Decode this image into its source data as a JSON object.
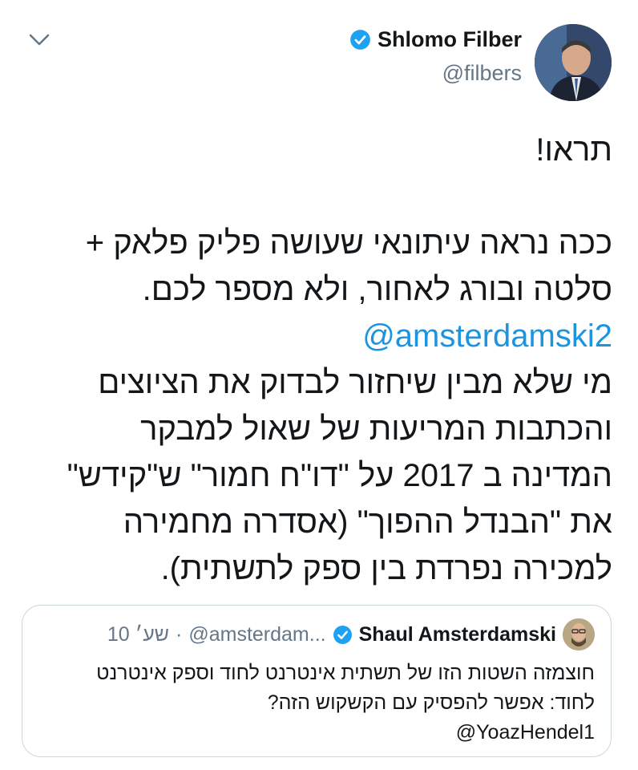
{
  "author": {
    "display_name": "Shlomo Filber",
    "handle": "@filbers",
    "verified_icon": "verified-badge-icon"
  },
  "tweet": {
    "lines": [
      "תראו!",
      "",
      "ככה נראה עיתונאי שעושה פליק פלאק +",
      "סלטה ובורג לאחור, ולא מספר לכם.",
      "@amsterdamski2",
      "מי שלא מבין שיחזור לבדוק את הציוצים",
      "והכתבות המריעות של שאול למבקר",
      "המדינה ב 2017 על \"דו\"ח חמור\" ש\"קידש\"",
      "את \"הבנדל ההפוך\" (אסדרה מחמירה",
      "למכירה נפרדת בין ספק לתשתית)."
    ]
  },
  "quoted_tweet": {
    "display_name": "Shaul Amsterdamski",
    "handle": "@amsterdam...",
    "separator": "·",
    "time": "10 שע׳",
    "lines": [
      "חוצמזה השטות הזו של תשתית אינטרנט לחוד וספק אינטרנט",
      "לחוד: אפשר להפסיק עם הקשקוש הזה?",
      "@YoazHendel1"
    ]
  },
  "colors": {
    "link": "#1b95e0",
    "verified": "#1da1f2",
    "secondary_text": "#657786",
    "border": "#ccd6dd"
  }
}
